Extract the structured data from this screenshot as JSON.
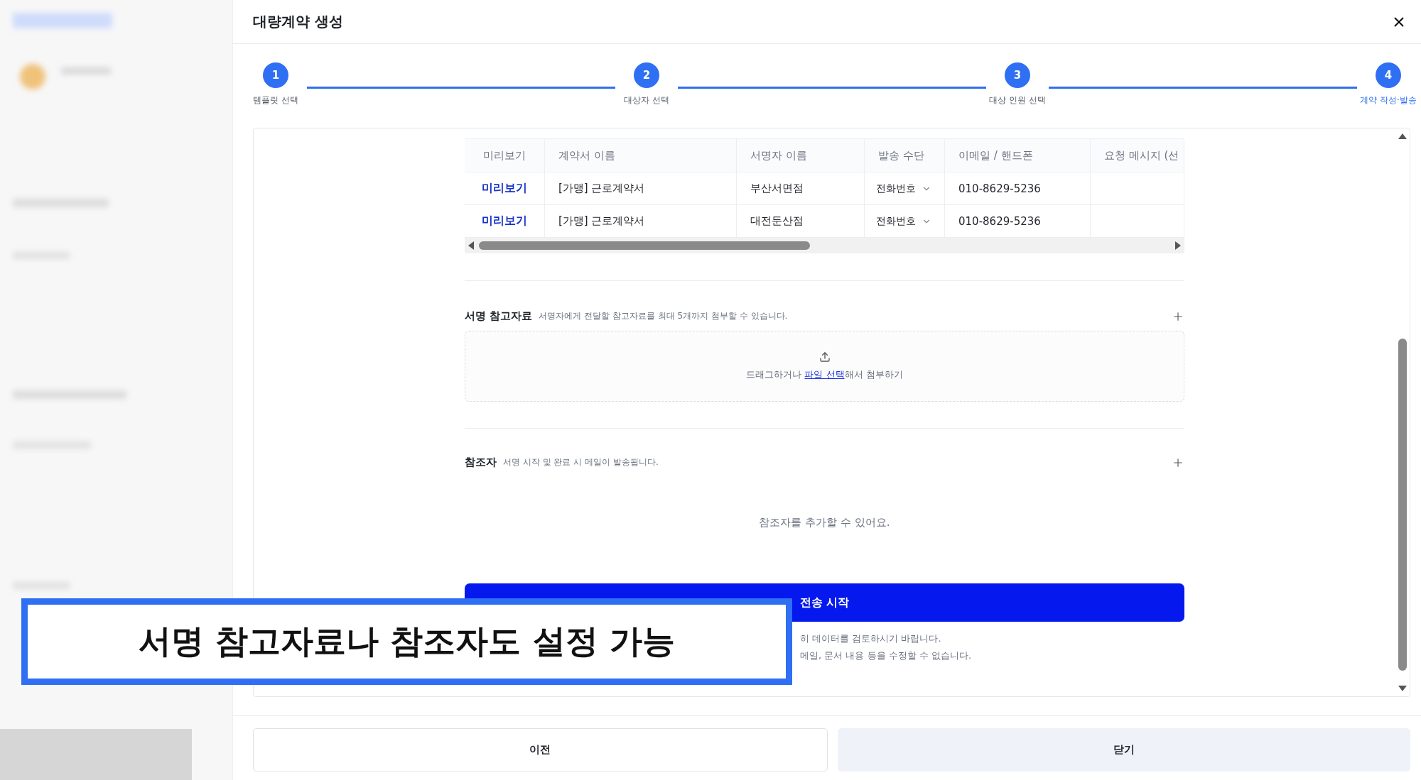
{
  "modal": {
    "title": "대량계약 생성"
  },
  "steps": [
    {
      "number": "1",
      "label": "템플릿 선택",
      "selected": false
    },
    {
      "number": "2",
      "label": "대상자 선택",
      "selected": false
    },
    {
      "number": "3",
      "label": "대상 인원 선택",
      "selected": false
    },
    {
      "number": "4",
      "label": "계약 작성·발송",
      "selected": true
    }
  ],
  "table": {
    "columns": [
      "미리보기",
      "계약서 이름",
      "서명자 이름",
      "발송 수단",
      "이메일 / 핸드폰",
      "요청 메시지 (선"
    ],
    "rows": [
      {
        "preview": "미리보기",
        "contract": "[가맹] 근로계약서",
        "signer": "부산서면점",
        "method": "전화번호",
        "contact": "010-8629-5236"
      },
      {
        "preview": "미리보기",
        "contract": "[가맹] 근로계약서",
        "signer": "대전둔산점",
        "method": "전화번호",
        "contact": "010-8629-5236"
      }
    ]
  },
  "attachments": {
    "title": "서명 참고자료",
    "description": "서명자에게 전달할 참고자료를 최대 5개까지 첨부할 수 있습니다.",
    "upload_prefix": "드래그하거나 ",
    "upload_link": "파일 선택",
    "upload_suffix": "해서 첨부하기"
  },
  "cc": {
    "title": "참조자",
    "description": "서명 시작 및 완료 시 메일이 발송됩니다.",
    "empty": "참조자를 추가할 수 있어요."
  },
  "submit": "전송 시작",
  "notes": [
    "히 데이터를 검토하시기 바랍니다.",
    "메일, 문서 내용 등을 수정할 수 없습니다."
  ],
  "footer": [
    {
      "label": "이전",
      "kind": "outline"
    },
    {
      "label": "닫기",
      "kind": "filled"
    }
  ],
  "caption": "서명 참고자료나 참조자도 설정 가능"
}
